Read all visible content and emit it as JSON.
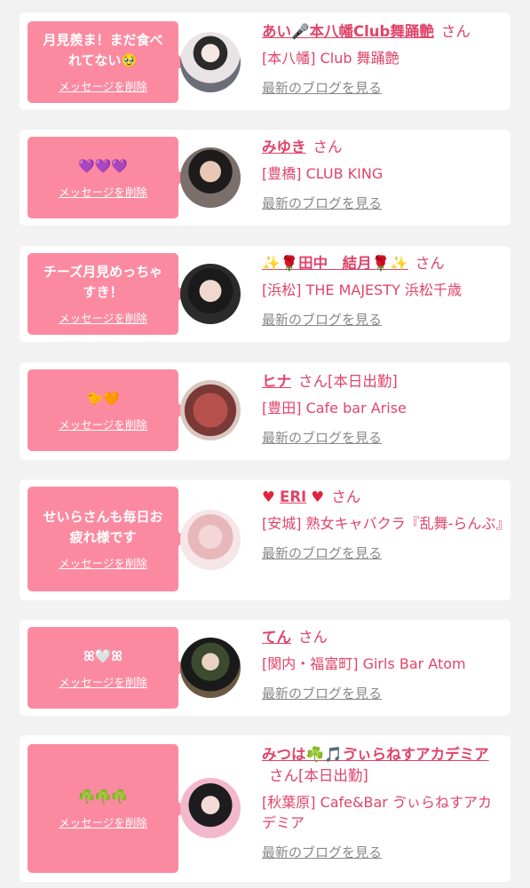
{
  "delete_label": "メッセージを削除",
  "blog_label": "最新のブログを見る",
  "san_label": "さん",
  "colors": {
    "accent": "#e0446a",
    "bubble": "#fb8aa1",
    "bg": "#f2f2f2"
  },
  "cards": [
    {
      "message": "月見羨ま！まだ食べれてない🥹",
      "name": "あい🎤本八幡Club舞踊艶",
      "suffix": "",
      "shop": "[本八幡] Club 舞踊艶"
    },
    {
      "message": "💜💜💜",
      "name": "みゆき",
      "suffix": "",
      "shop": "[豊橋] CLUB KING"
    },
    {
      "message": "チーズ月見めっちゃすき！",
      "name": "✨🌹田中　結月🌹✨",
      "suffix": "",
      "shop": "[浜松] THE MAJESTY 浜松千歳"
    },
    {
      "message": "🐤🧡",
      "name": "ヒナ",
      "suffix": "[本日出勤]",
      "shop": "[豊田] Cafe bar Arise"
    },
    {
      "message": "せいらさんも毎日お疲れ様です",
      "name": "ERI",
      "suffix": "",
      "shop": "[安城] 熟女キャバクラ『乱舞-らんぶ』"
    },
    {
      "message": "ꕤ🤍ꕤ",
      "name": "てん",
      "suffix": "",
      "shop": "[関内・福富町] Girls Bar Atom"
    },
    {
      "message": "☘️☘️☘️",
      "name": "みつは☘️🎵ゔぃらねすアカデミア",
      "suffix": "[本日出勤]",
      "shop": "[秋葉原] Cafe&Bar ゔぃらねすアカデミア"
    }
  ]
}
